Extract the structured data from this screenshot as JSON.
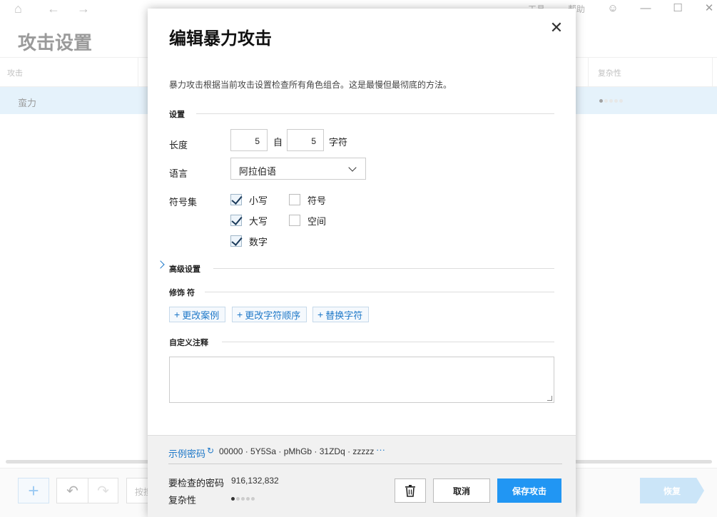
{
  "app": {
    "menu": {
      "tools": "工具",
      "help": "帮助"
    },
    "page_title": "攻击设置",
    "table": {
      "columns": {
        "attack": "攻击",
        "complexity": "复杂性"
      },
      "rows": [
        {
          "name": "蛮力",
          "complexity_level": 1,
          "complexity_max": 5
        }
      ]
    },
    "bottom": {
      "search_placeholder": "按搜",
      "restore_label": "恢复"
    }
  },
  "modal": {
    "title": "编辑暴力攻击",
    "description": "暴力攻击根据当前攻击设置检查所有角色组合。这是最慢但最彻底的方法。",
    "settings": {
      "heading": "设置",
      "length": {
        "label": "长度",
        "from": "5",
        "to_word": "自",
        "to": "5",
        "unit": "字符"
      },
      "language": {
        "label": "语言",
        "selected": "阿拉伯语"
      },
      "charset": {
        "label": "符号集",
        "options": [
          {
            "label": "小写",
            "checked": true
          },
          {
            "label": "符号",
            "checked": false
          },
          {
            "label": "大写",
            "checked": true
          },
          {
            "label": "空间",
            "checked": false
          },
          {
            "label": "数字",
            "checked": true
          }
        ]
      }
    },
    "advanced": {
      "heading": "高级设置"
    },
    "modifiers": {
      "heading": "修饰 符",
      "buttons": [
        "更改案例",
        "更改字符顺序",
        "替换字符"
      ]
    },
    "custom_notes": {
      "heading": "自定义注释",
      "value": ""
    },
    "footer": {
      "example_label": "示例密码",
      "example_values": "00000 · 5Y5Sa · pMhGb · 31ZDq · zzzzz",
      "more": "···",
      "passwords_label": "要检查的密码",
      "passwords_value": "916,132,832",
      "complexity_label": "复杂性",
      "complexity_level": 1,
      "complexity_max": 5,
      "cancel_label": "取消",
      "save_label": "保存攻击"
    }
  },
  "colors": {
    "accent": "#2196f3",
    "link": "#1e78c8",
    "row_highlight": "#c6e3f7"
  }
}
